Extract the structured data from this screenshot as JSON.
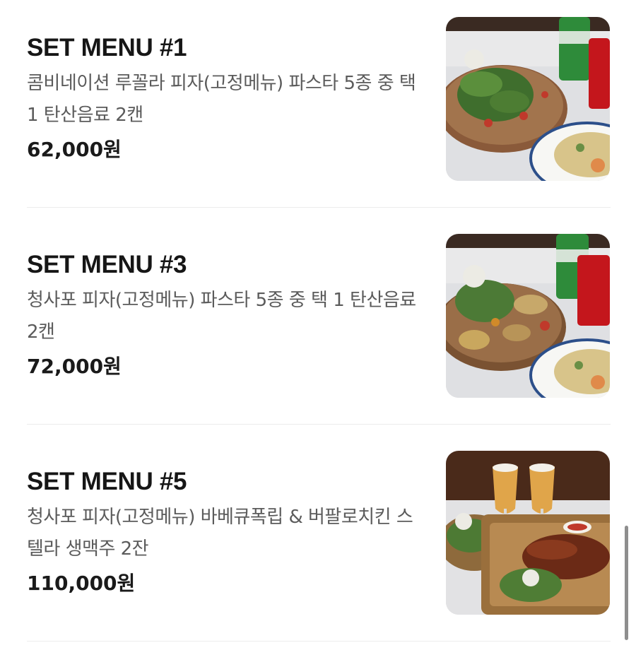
{
  "menu": {
    "items": [
      {
        "title": "SET MENU #1",
        "description": "콤비네이션 루꼴라 피자(고정메뉴) 파스타 5종 중 택 1 탄산음료 2캔",
        "price": "62,000원",
        "photo_icon": "pizza-pasta-soda-photo"
      },
      {
        "title": "SET MENU #3",
        "description": "청사포 피자(고정메뉴) 파스타 5종 중 택 1 탄산음료 2캔",
        "price": "72,000원",
        "photo_icon": "pizza-pasta-soda-photo"
      },
      {
        "title": "SET MENU #5",
        "description": "청사포 피자(고정메뉴) 바베큐폭립 & 버팔로치킨 스텔라 생맥주 2잔",
        "price": "110,000원",
        "photo_icon": "ribs-beer-photo"
      }
    ]
  },
  "colors": {
    "title": "#161616",
    "description": "#5b5b5b",
    "price": "#1a1a1a",
    "divider": "#ececec"
  }
}
